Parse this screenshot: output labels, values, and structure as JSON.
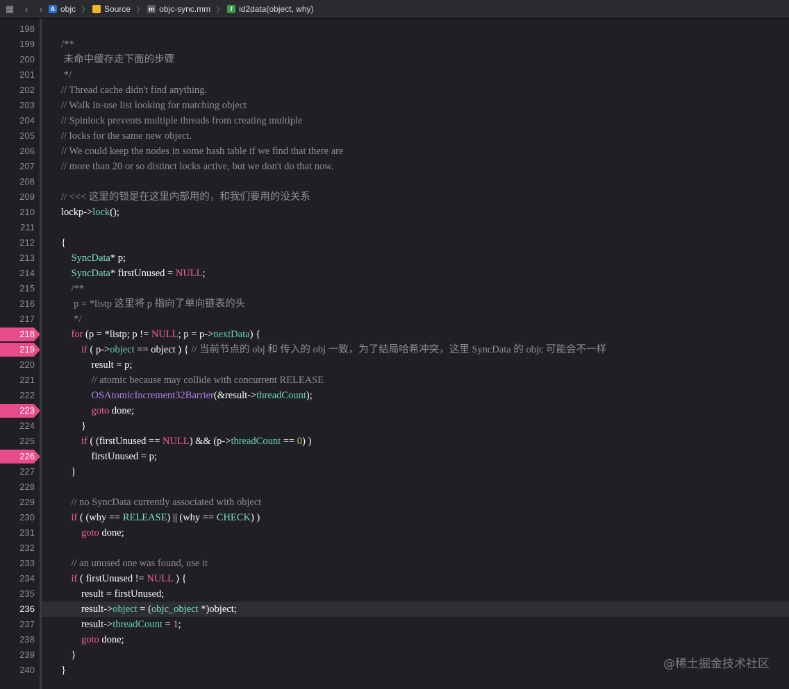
{
  "breadcrumb": {
    "items": [
      {
        "label": "objc",
        "icon": "xcode-project-icon"
      },
      {
        "label": "Source",
        "icon": "folder-icon"
      },
      {
        "label": "objc-sync.mm",
        "icon": "source-file-icon"
      },
      {
        "label": "id2data(object, why)",
        "icon": "function-icon"
      }
    ]
  },
  "lines": [
    {
      "n": "198",
      "t": []
    },
    {
      "n": "199",
      "t": [
        [
          "cm",
          "/**"
        ]
      ]
    },
    {
      "n": "200",
      "t": [
        [
          "cm",
          " 未命中缓存走下面的步骤"
        ]
      ]
    },
    {
      "n": "201",
      "t": [
        [
          "cm",
          " */"
        ]
      ]
    },
    {
      "n": "202",
      "t": [
        [
          "cm",
          "// Thread cache didn't find anything."
        ]
      ]
    },
    {
      "n": "203",
      "t": [
        [
          "cm",
          "// Walk in-use list looking for matching object"
        ]
      ]
    },
    {
      "n": "204",
      "t": [
        [
          "cm",
          "// Spinlock prevents multiple threads from creating multiple"
        ]
      ]
    },
    {
      "n": "205",
      "t": [
        [
          "cm",
          "// locks for the same new object."
        ]
      ]
    },
    {
      "n": "206",
      "t": [
        [
          "cm",
          "// We could keep the nodes in some hash table if we find that there are"
        ]
      ]
    },
    {
      "n": "207",
      "t": [
        [
          "cm",
          "// more than 20 or so distinct locks active, but we don't do that now."
        ]
      ]
    },
    {
      "n": "208",
      "t": []
    },
    {
      "n": "209",
      "t": [
        [
          "cm",
          "// <<< 这里的锁是在这里内部用的，和我们要用的没关系"
        ]
      ]
    },
    {
      "n": "210",
      "t": [
        [
          "",
          "lockp->"
        ],
        [
          "pr",
          "lock"
        ],
        [
          "",
          "();"
        ]
      ]
    },
    {
      "n": "211",
      "t": []
    },
    {
      "n": "212",
      "t": [
        [
          "",
          "{"
        ]
      ]
    },
    {
      "n": "213",
      "t": [
        [
          "",
          "    "
        ],
        [
          "ty",
          "SyncData"
        ],
        [
          "",
          "* p;"
        ]
      ]
    },
    {
      "n": "214",
      "t": [
        [
          "",
          "    "
        ],
        [
          "ty",
          "SyncData"
        ],
        [
          "",
          "* firstUnused = "
        ],
        [
          "kw",
          "NULL"
        ],
        [
          "",
          ";"
        ]
      ]
    },
    {
      "n": "215",
      "t": [
        [
          "cm",
          "    /**"
        ]
      ]
    },
    {
      "n": "216",
      "t": [
        [
          "cm",
          "     p = *listp 这里将 p 指向了单向链表的头"
        ]
      ]
    },
    {
      "n": "217",
      "t": [
        [
          "cm",
          "     */"
        ]
      ]
    },
    {
      "n": "218",
      "bp": true,
      "t": [
        [
          "",
          "    "
        ],
        [
          "kw",
          "for"
        ],
        [
          "",
          " (p = *listp; p != "
        ],
        [
          "kw",
          "NULL"
        ],
        [
          "",
          "; p = p->"
        ],
        [
          "pr",
          "nextData"
        ],
        [
          "",
          ") {"
        ]
      ]
    },
    {
      "n": "219",
      "bp": true,
      "t": [
        [
          "",
          "        "
        ],
        [
          "kw",
          "if"
        ],
        [
          "",
          " ( p->"
        ],
        [
          "pr",
          "object"
        ],
        [
          "",
          " == object ) { "
        ],
        [
          "cm",
          "// 当前节点的 obj 和 传入的 obj 一致，为了结局哈希冲突，这里 SyncData 的 objc 可能会不一样"
        ]
      ]
    },
    {
      "n": "220",
      "t": [
        [
          "",
          "            result = p;"
        ]
      ]
    },
    {
      "n": "221",
      "t": [
        [
          "",
          "            "
        ],
        [
          "cm",
          "// atomic because may collide with concurrent RELEASE"
        ]
      ]
    },
    {
      "n": "222",
      "t": [
        [
          "",
          "            "
        ],
        [
          "fn",
          "OSAtomicIncrement32Barrier"
        ],
        [
          "",
          "(&result->"
        ],
        [
          "pr",
          "threadCount"
        ],
        [
          "",
          ");"
        ]
      ]
    },
    {
      "n": "223",
      "bp": true,
      "t": [
        [
          "",
          "            "
        ],
        [
          "kw",
          "goto"
        ],
        [
          "",
          " done;"
        ]
      ]
    },
    {
      "n": "224",
      "t": [
        [
          "",
          "        }"
        ]
      ]
    },
    {
      "n": "225",
      "t": [
        [
          "",
          "        "
        ],
        [
          "kw",
          "if"
        ],
        [
          "",
          " ( (firstUnused == "
        ],
        [
          "kw",
          "NULL"
        ],
        [
          "",
          ") && (p->"
        ],
        [
          "pr",
          "threadCount"
        ],
        [
          "",
          " == "
        ],
        [
          "nm",
          "0"
        ],
        [
          "",
          ") )"
        ]
      ]
    },
    {
      "n": "226",
      "bp": true,
      "t": [
        [
          "",
          "            firstUnused = p;"
        ]
      ]
    },
    {
      "n": "227",
      "t": [
        [
          "",
          "    }"
        ]
      ]
    },
    {
      "n": "228",
      "t": []
    },
    {
      "n": "229",
      "t": [
        [
          "",
          "    "
        ],
        [
          "cm",
          "// no SyncData currently associated with object"
        ]
      ]
    },
    {
      "n": "230",
      "t": [
        [
          "",
          "    "
        ],
        [
          "kw",
          "if"
        ],
        [
          "",
          " ( (why == "
        ],
        [
          "ty",
          "RELEASE"
        ],
        [
          "",
          ") || (why == "
        ],
        [
          "ty",
          "CHECK"
        ],
        [
          "",
          ") )"
        ]
      ]
    },
    {
      "n": "231",
      "t": [
        [
          "",
          "        "
        ],
        [
          "kw",
          "goto"
        ],
        [
          "",
          " done;"
        ]
      ]
    },
    {
      "n": "232",
      "t": []
    },
    {
      "n": "233",
      "t": [
        [
          "",
          "    "
        ],
        [
          "cm",
          "// an unused one was found, use it"
        ]
      ]
    },
    {
      "n": "234",
      "t": [
        [
          "",
          "    "
        ],
        [
          "kw",
          "if"
        ],
        [
          "",
          " ( firstUnused != "
        ],
        [
          "kw",
          "NULL"
        ],
        [
          "",
          " ) {"
        ]
      ]
    },
    {
      "n": "235",
      "t": [
        [
          "",
          "        result = firstUnused;"
        ]
      ]
    },
    {
      "n": "236",
      "cur": true,
      "t": [
        [
          "",
          "        result->"
        ],
        [
          "pr",
          "object"
        ],
        [
          "",
          " = ("
        ],
        [
          "ty",
          "objc_object"
        ],
        [
          "",
          " *)object;"
        ]
      ]
    },
    {
      "n": "237",
      "t": [
        [
          "",
          "        result->"
        ],
        [
          "pr",
          "threadCount"
        ],
        [
          "",
          " = "
        ],
        [
          "nm",
          "1"
        ],
        [
          "",
          ";"
        ]
      ]
    },
    {
      "n": "238",
      "t": [
        [
          "",
          "        "
        ],
        [
          "kw",
          "goto"
        ],
        [
          "",
          " done;"
        ]
      ]
    },
    {
      "n": "239",
      "t": [
        [
          "",
          "    }"
        ]
      ]
    },
    {
      "n": "240",
      "t": [
        [
          "",
          "}"
        ]
      ]
    }
  ],
  "watermark": "@稀土掘金技术社区",
  "colors": {
    "background": "#1f1f24",
    "breakpoint": "#e84c8a",
    "keyword": "#fc5fa3",
    "type": "#7ee3c3",
    "property": "#67d4b4",
    "function": "#b281eb",
    "number": "#d0bf69",
    "comment": "#8f8f95"
  }
}
